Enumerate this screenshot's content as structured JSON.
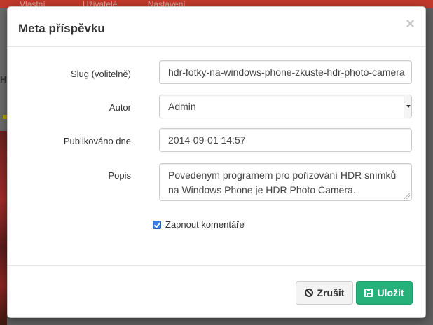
{
  "background": {
    "nav": [
      "Vlastní",
      "Uživatelé",
      "Nastavení"
    ],
    "heading_fragment": "H"
  },
  "modal": {
    "title": "Meta příspěvku",
    "close_glyph": "×",
    "fields": {
      "slug_label": "Slug (volitelně)",
      "slug_value": "hdr-fotky-na-windows-phone-zkuste-hdr-photo-camera",
      "author_label": "Autor",
      "author_value": "Admin",
      "published_label": "Publikováno dne",
      "published_value": "2014-09-01 14:57",
      "description_label": "Popis",
      "description_value": "Povedeným programem pro pořizování HDR snímků na Windows Phone je HDR Photo Camera."
    },
    "comments_label": "Zapnout komentáře",
    "comments_checked": true,
    "buttons": {
      "cancel": "Zrušit",
      "save": "Uložit"
    }
  },
  "colors": {
    "accent_red": "#c0392b",
    "save_green": "#26b07a",
    "checkbox_blue": "#3b7de0"
  }
}
